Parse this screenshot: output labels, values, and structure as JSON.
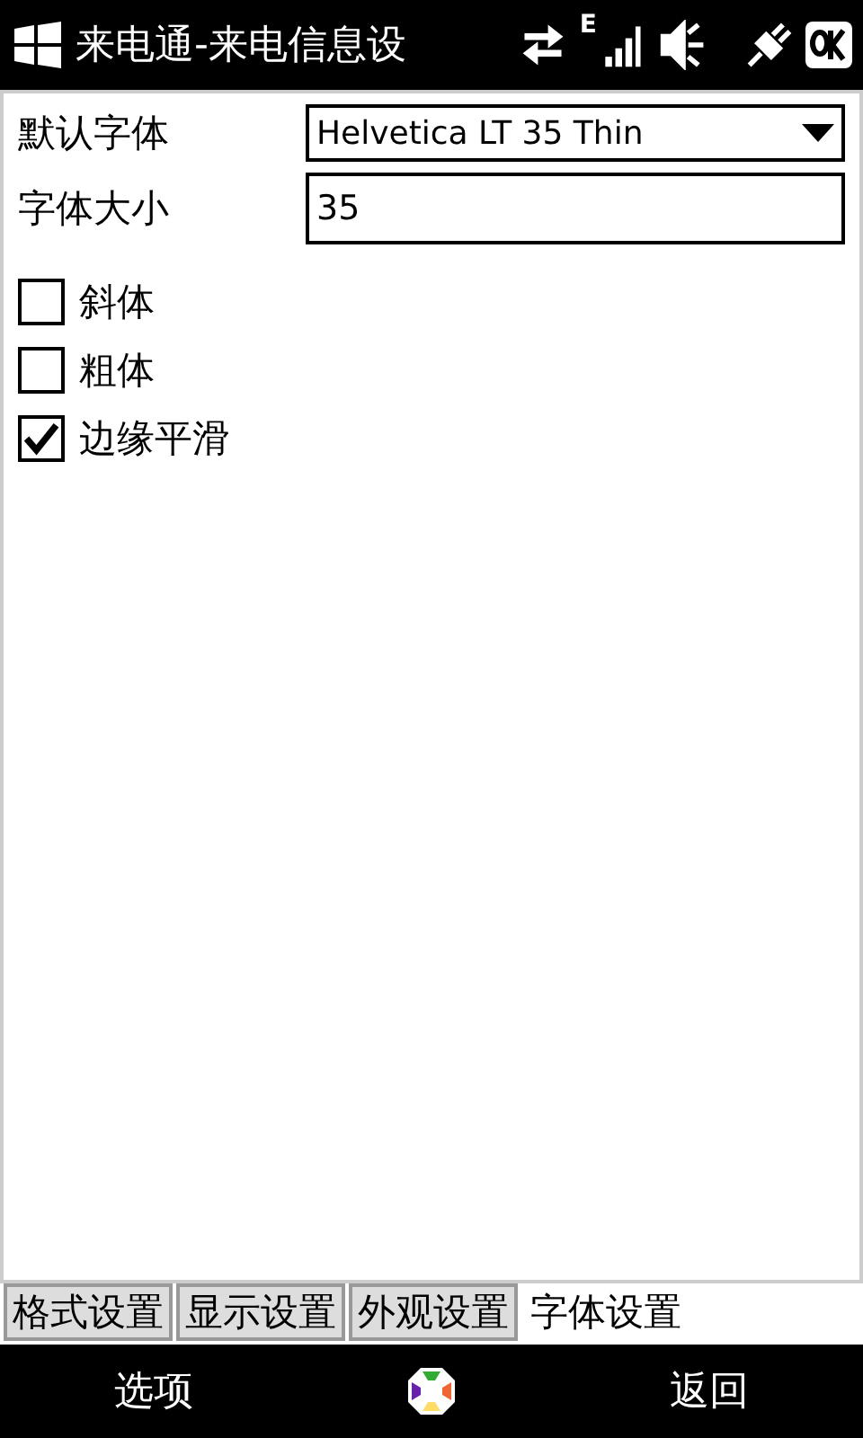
{
  "status_bar": {
    "title": "来电通-来电信息设",
    "network": "E"
  },
  "fields": [
    {
      "kind": "dropdown",
      "label": "默认字体",
      "value": "Helvetica LT 35 Thin"
    },
    {
      "kind": "text",
      "label": "字体大小",
      "value": "35"
    }
  ],
  "checkboxes": [
    {
      "label": "斜体",
      "checked": false
    },
    {
      "label": "粗体",
      "checked": false
    },
    {
      "label": "边缘平滑",
      "checked": true
    }
  ],
  "tabs": [
    {
      "label": "格式设置",
      "selected": false
    },
    {
      "label": "显示设置",
      "selected": false
    },
    {
      "label": "外观设置",
      "selected": false
    },
    {
      "label": "字体设置",
      "selected": true
    }
  ],
  "softkeys": {
    "left": "选项",
    "right": "返回"
  }
}
